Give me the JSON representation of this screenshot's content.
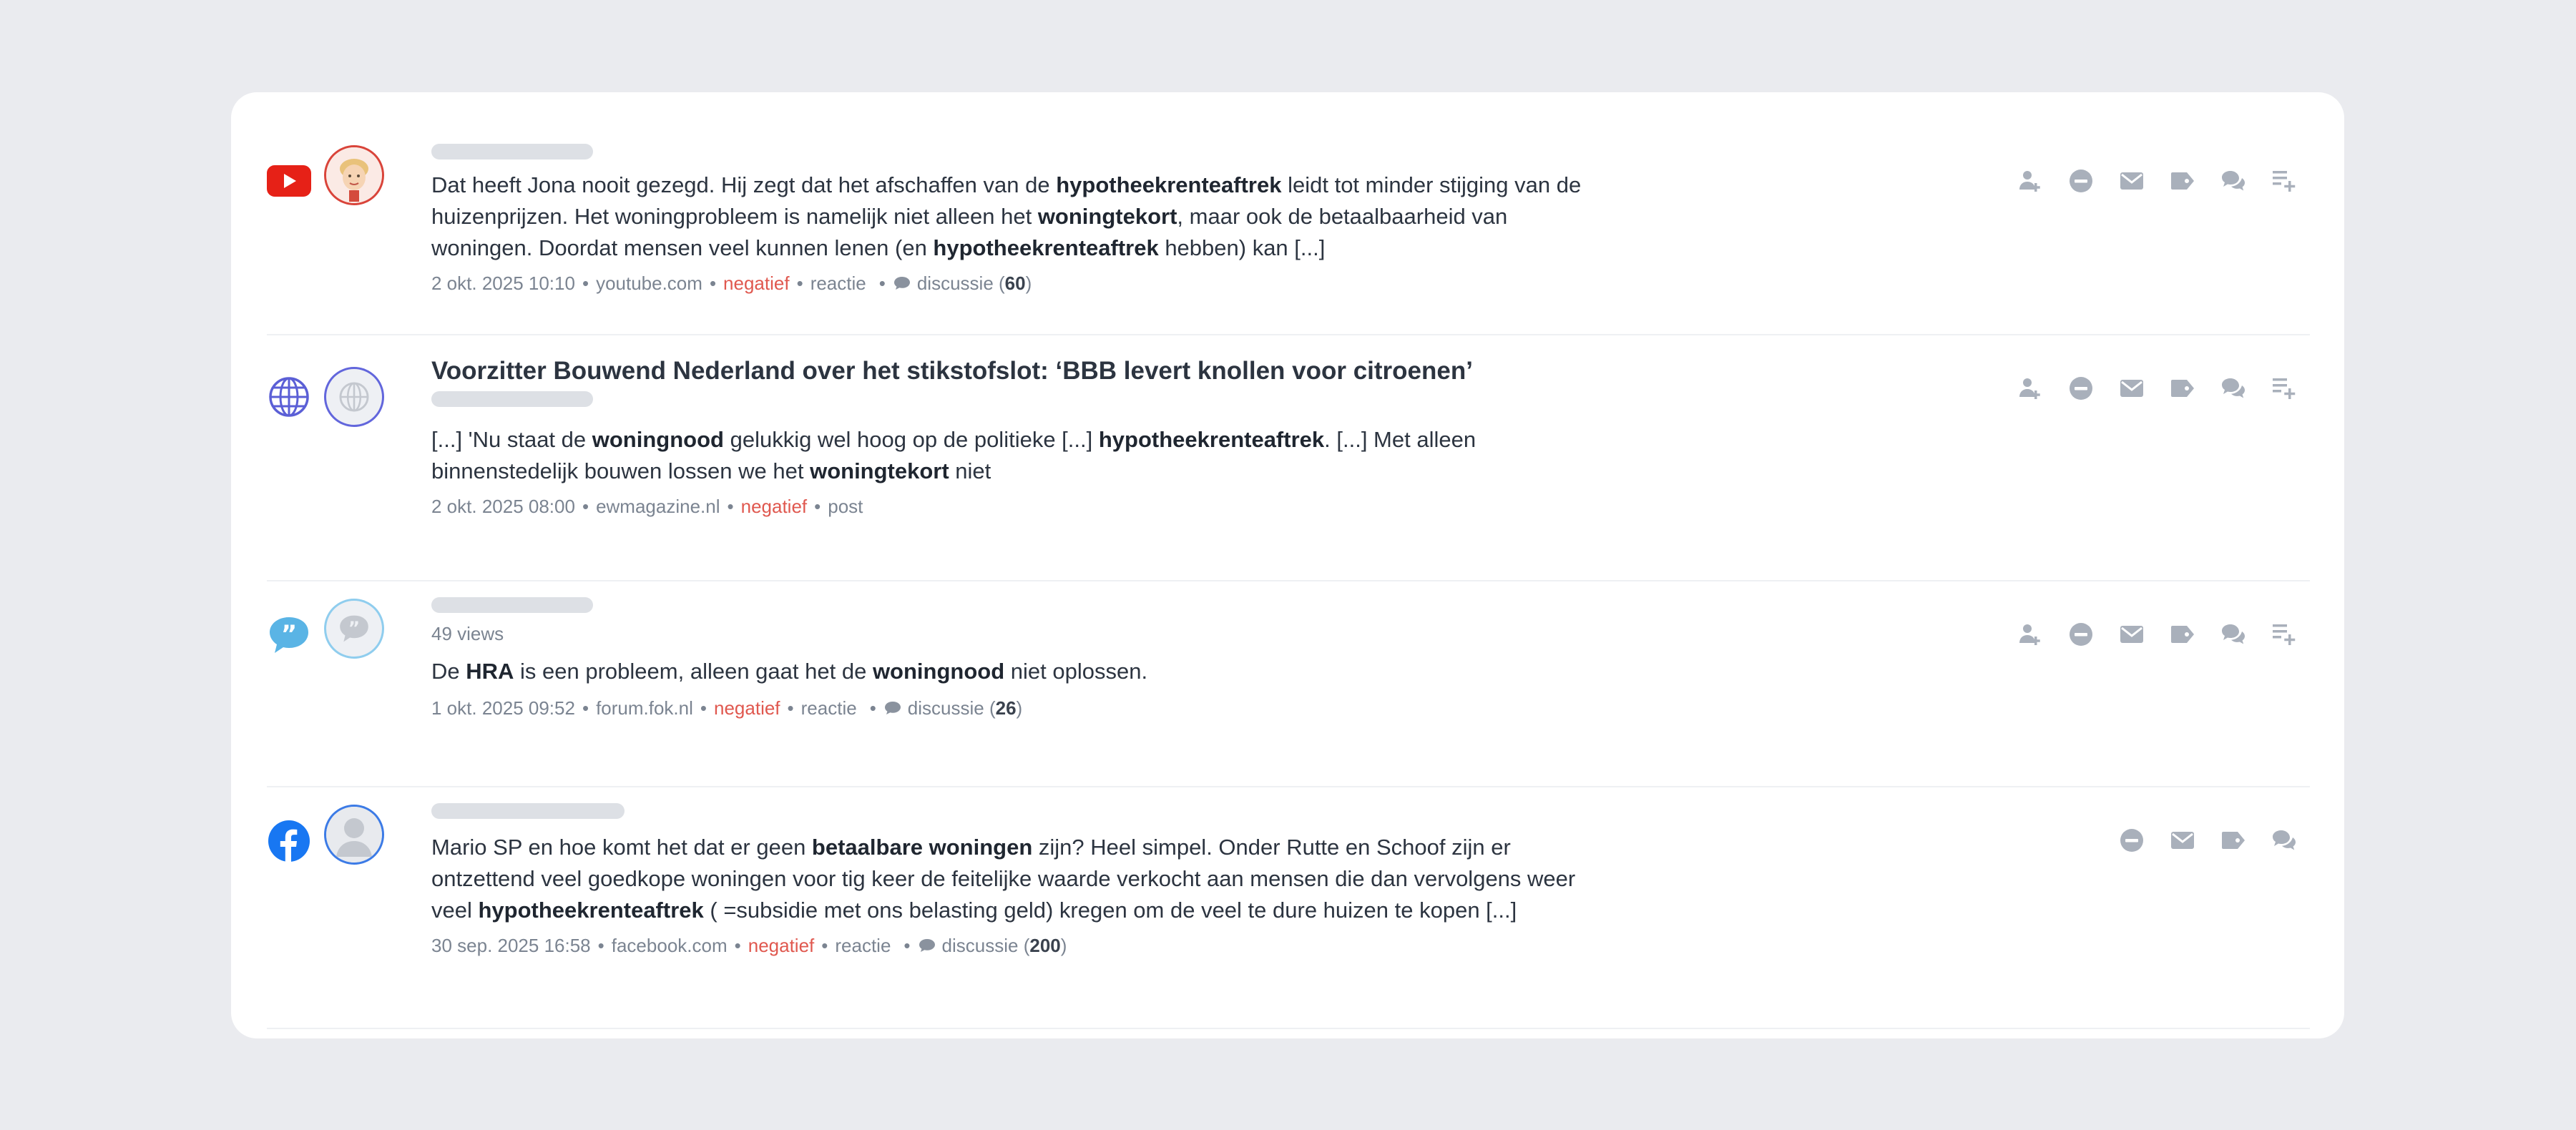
{
  "mentions": [
    {
      "source_icon": "youtube-icon",
      "avatar": "cartoon-avatar",
      "title": "",
      "views": "",
      "text_parts": [
        {
          "t": "Dat heeft Jona nooit gezegd. Hij zegt dat het afschaffen van de ",
          "b": false
        },
        {
          "t": "hypotheekrenteaftrek",
          "b": true
        },
        {
          "t": " leidt tot minder stijging van de huizenprijzen. Het woningprobleem is namelijk niet alleen het ",
          "b": false
        },
        {
          "t": "woningtekort",
          "b": true
        },
        {
          "t": ", maar ook de betaalbaarheid van woningen. Doordat mensen veel kunnen lenen (en ",
          "b": false
        },
        {
          "t": "hypotheekrenteaftrek",
          "b": true
        },
        {
          "t": " hebben) kan [...]",
          "b": false
        }
      ],
      "date": "2 okt. 2025 10:10",
      "domain": "youtube.com",
      "sentiment": "negatief",
      "type": "reactie",
      "discussion_label": "discussie",
      "discussion_count": "60",
      "actions": [
        "add-author-icon",
        "mute-icon",
        "mail-icon",
        "tag-icon",
        "chat-icon",
        "add-to-list-icon"
      ]
    },
    {
      "source_icon": "globe-icon",
      "avatar": "globe-avatar",
      "title": "Voorzitter Bouwend Nederland over het stikstofslot: ‘BBB levert knollen voor citroenen’",
      "views": "",
      "text_parts": [
        {
          "t": "[...] 'Nu staat de ",
          "b": false
        },
        {
          "t": "woningnood",
          "b": true
        },
        {
          "t": " gelukkig wel hoog op de politieke [...] ",
          "b": false
        },
        {
          "t": "hypotheekrenteaftrek",
          "b": true
        },
        {
          "t": ". [...] Met alleen binnenstedelijk bouwen lossen we het ",
          "b": false
        },
        {
          "t": "woningtekort",
          "b": true
        },
        {
          "t": " niet",
          "b": false
        }
      ],
      "date": "2 okt. 2025 08:00",
      "domain": "ewmagazine.nl",
      "sentiment": "negatief",
      "type": "post",
      "discussion_label": "",
      "discussion_count": "",
      "actions": [
        "add-author-icon",
        "mute-icon",
        "mail-icon",
        "tag-icon",
        "chat-icon",
        "add-to-list-icon"
      ]
    },
    {
      "source_icon": "quote-bubble-icon",
      "avatar": "forum-avatar",
      "title": "",
      "views": "49 views",
      "text_parts": [
        {
          "t": "De ",
          "b": false
        },
        {
          "t": "HRA",
          "b": true
        },
        {
          "t": " is een probleem, alleen gaat het de ",
          "b": false
        },
        {
          "t": "woningnood",
          "b": true
        },
        {
          "t": " niet oplossen.",
          "b": false
        }
      ],
      "date": "1 okt. 2025 09:52",
      "domain": "forum.fok.nl",
      "sentiment": "negatief",
      "type": "reactie",
      "discussion_label": "discussie",
      "discussion_count": "26",
      "actions": [
        "add-author-icon",
        "mute-icon",
        "mail-icon",
        "tag-icon",
        "chat-icon",
        "add-to-list-icon"
      ]
    },
    {
      "source_icon": "facebook-icon",
      "avatar": "person-avatar",
      "title": "",
      "views": "",
      "text_parts": [
        {
          "t": "Mario SP en hoe komt het dat er geen ",
          "b": false
        },
        {
          "t": "betaalbare woningen",
          "b": true
        },
        {
          "t": " zijn? Heel simpel. Onder Rutte en Schoof zijn er ontzettend veel goedkope woningen voor tig keer de feitelijke waarde verkocht aan mensen die dan vervolgens weer veel ",
          "b": false
        },
        {
          "t": "hypotheekrenteaftrek",
          "b": true
        },
        {
          "t": " ( =subsidie met ons belasting geld) kregen om de veel te dure huizen te kopen [...]",
          "b": false
        }
      ],
      "date": "30 sep. 2025 16:58",
      "domain": "facebook.com",
      "sentiment": "negatief",
      "type": "reactie",
      "discussion_label": "discussie",
      "discussion_count": "200",
      "actions": [
        "mute-icon",
        "mail-icon",
        "tag-icon",
        "chat-icon"
      ]
    }
  ],
  "colors": {
    "background": "#eaebef",
    "card": "#ffffff",
    "negative": "#e0584f",
    "muted": "#7b8491",
    "icon": "#a9b0bb",
    "youtube": "#e62117",
    "facebook": "#1877f2",
    "globe": "#5b5fd6",
    "forum": "#5ab4e5"
  }
}
